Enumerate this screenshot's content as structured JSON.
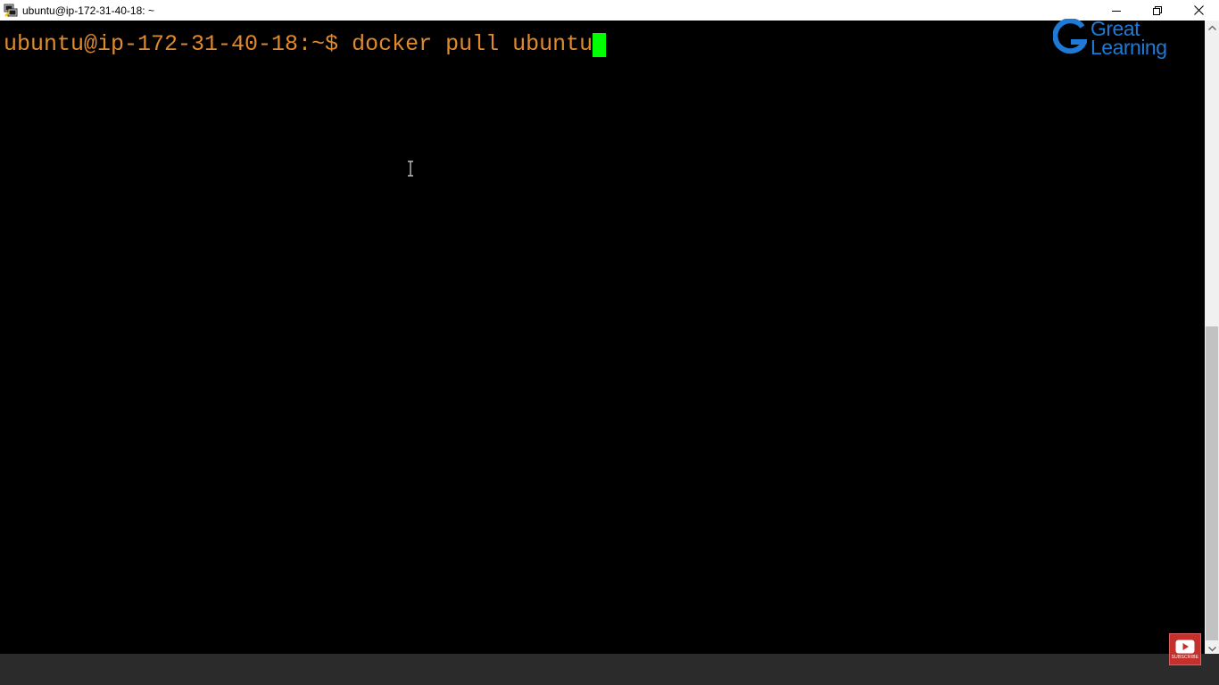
{
  "window": {
    "title": "ubuntu@ip-172-31-40-18: ~",
    "app_icon": "putty-icon",
    "controls": [
      "minimize-icon",
      "restore-icon",
      "close-icon"
    ]
  },
  "terminal": {
    "prompt": "ubuntu@ip-172-31-40-18:~$ ",
    "command": "docker pull ubuntu",
    "colors": {
      "text": "#e08a2e",
      "cursor": "#00ff00",
      "background": "#000000"
    }
  },
  "logo": {
    "line1": "Great",
    "line2": "Learning",
    "color": "#1e7ad6"
  },
  "subscribe": {
    "label": "SUBSCRIBE",
    "icon": "play-icon",
    "color": "#c4302b"
  }
}
